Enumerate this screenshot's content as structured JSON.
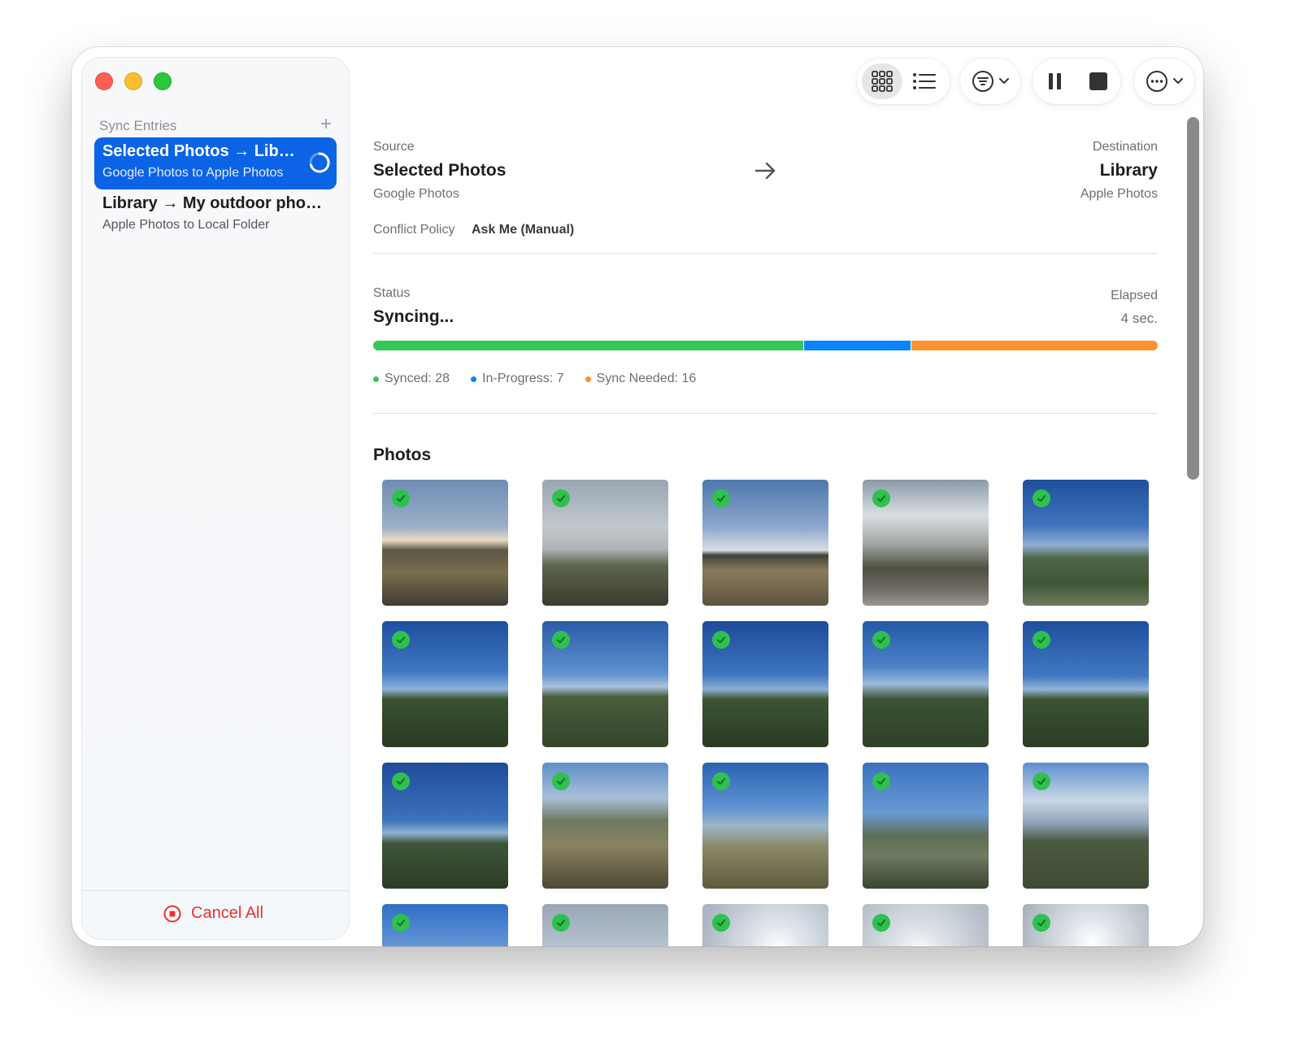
{
  "sidebar": {
    "header": "Sync Entries",
    "add_label": "+",
    "entries": [
      {
        "title": "Selected Photos → Library",
        "subtitle": "Google Photos to Apple Photos",
        "active": true
      },
      {
        "title": "Library → My outdoor photos",
        "subtitle": "Apple Photos to Local Folder",
        "active": false
      }
    ],
    "cancel_label": "Cancel All"
  },
  "toolbar": {
    "view_modes": [
      "grid-icon",
      "list-icon"
    ],
    "selected_view": "grid-icon",
    "filter": "filter-icon",
    "controls": [
      "pause-icon",
      "stop-icon"
    ],
    "more": "more-icon"
  },
  "detail": {
    "source_label": "Source",
    "source_name": "Selected Photos",
    "source_service": "Google Photos",
    "destination_label": "Destination",
    "destination_name": "Library",
    "destination_service": "Apple Photos",
    "conflict_label": "Conflict Policy",
    "conflict_value": "Ask Me (Manual)",
    "status_label": "Status",
    "status_value": "Syncing...",
    "elapsed_label": "Elapsed",
    "elapsed_value": "4 sec.",
    "legend": [
      {
        "label": "Synced: 28",
        "count": 28,
        "color": "#34c759"
      },
      {
        "label": "In-Progress: 7",
        "count": 7,
        "color": "#0a84ff"
      },
      {
        "label": "Sync Needed: 16",
        "count": 16,
        "color": "#ff9230"
      }
    ],
    "photos_title": "Photos"
  },
  "photos": [
    {
      "synced": true
    },
    {
      "synced": true
    },
    {
      "synced": true
    },
    {
      "synced": true
    },
    {
      "synced": true
    },
    {
      "synced": true
    },
    {
      "synced": true
    },
    {
      "synced": true
    },
    {
      "synced": true
    },
    {
      "synced": true
    },
    {
      "synced": true
    },
    {
      "synced": true
    },
    {
      "synced": true
    },
    {
      "synced": true
    },
    {
      "synced": true
    },
    {
      "synced": true
    },
    {
      "synced": true
    },
    {
      "synced": true
    },
    {
      "synced": true
    },
    {
      "synced": true
    }
  ]
}
